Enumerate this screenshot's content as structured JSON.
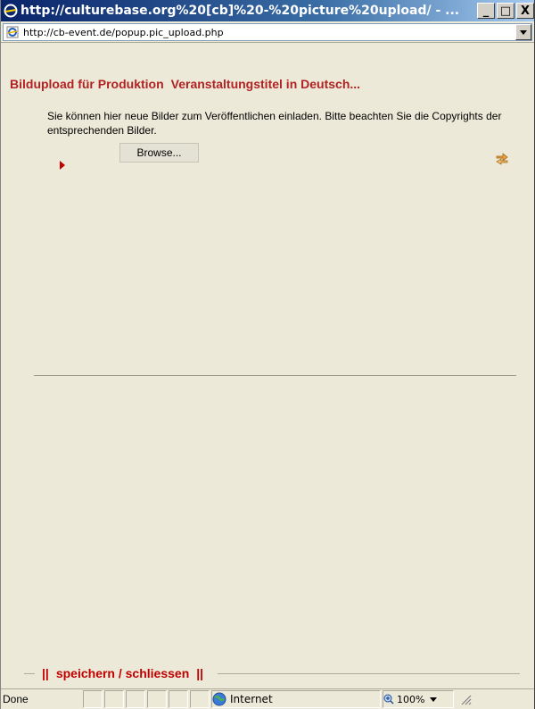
{
  "window": {
    "title": "http://culturebase.org%20[cb]%20-%20picture%20upload/ - ...",
    "minimize_label": "_",
    "maximize_label": "□",
    "close_label": "X"
  },
  "address": {
    "url": "http://cb-event.de/popup.pic_upload.php"
  },
  "content": {
    "title_part1": "Bildupload für Produktion",
    "title_part2": "Veranstaltungstitel in Deutsch...",
    "description": "Sie können hier neue Bilder zum Veröffentlichen einladen. Bitte beachten Sie die Copyrights der entsprechenden Bilder.",
    "browse_label": "Browse..."
  },
  "actionbar": {
    "separator_left": "||",
    "save_close_label": "speichern / schliessen",
    "separator_right": "||"
  },
  "statusbar": {
    "status_text": "Done",
    "zone_text": "Internet",
    "zoom_text": "100%"
  },
  "colors": {
    "accent_red": "#c00000",
    "title_red": "#b22222",
    "background": "#ece9d8"
  }
}
